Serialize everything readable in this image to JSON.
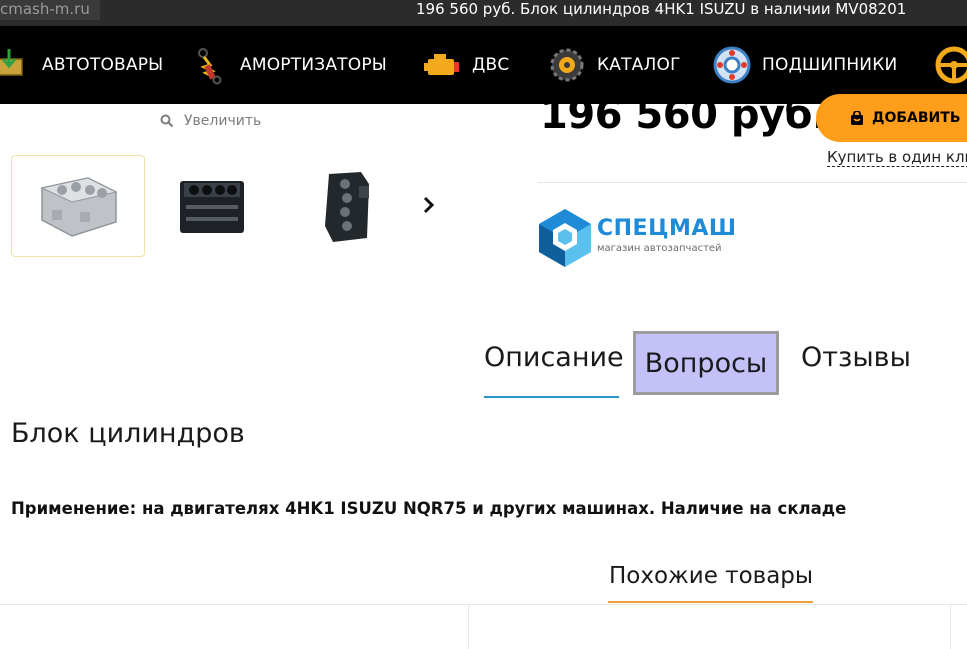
{
  "browser": {
    "url": "cmash-m.ru",
    "title": "196 560 руб. Блок цилиндров 4HK1 ISUZU в наличии MV08201"
  },
  "nav": {
    "items": [
      {
        "label": "АВТОТОВАРЫ",
        "icon": "auto-goods-icon"
      },
      {
        "label": "АМОРТИЗАТОРЫ",
        "icon": "shock-absorber-icon"
      },
      {
        "label": "ДВС",
        "icon": "engine-icon"
      },
      {
        "label": "КАТАЛОГ",
        "icon": "catalog-gear-icon"
      },
      {
        "label": "ПОДШИПНИКИ",
        "icon": "bearing-icon"
      }
    ]
  },
  "gallery": {
    "zoom_label": "Увеличить",
    "thumbs": [
      "cylinder-block-thumb-1",
      "cylinder-block-thumb-2",
      "cylinder-block-thumb-3"
    ]
  },
  "product": {
    "price": "196 560 руб.",
    "add_label": "ДОБАВИТЬ",
    "one_click_label": "Купить в один кли",
    "name": "Блок цилиндров",
    "application": "Применение: на двигателях 4HK1 ISUZU NQR75 и других машинах. Наличие на складе"
  },
  "logo": {
    "brand": "СПЕЦМАШ",
    "tagline": "магазин автозапчастей",
    "colors": {
      "primary": "#1f8bd6",
      "light": "#5ac0ee",
      "dark": "#0f5f9c"
    }
  },
  "tabs": {
    "description": "Описание",
    "questions": "Вопросы",
    "reviews": "Отзывы"
  },
  "similar": {
    "title": "Похожие товары"
  },
  "colors": {
    "accent": "#ff9e1a",
    "tab_underline": "#2a94c9",
    "similar_underline": "#e8a33a",
    "highlight": "#c4c1f8"
  }
}
